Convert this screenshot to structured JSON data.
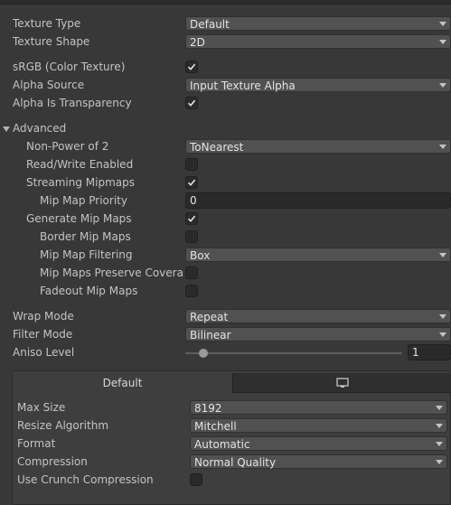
{
  "texture_type": {
    "label": "Texture Type",
    "value": "Default"
  },
  "texture_shape": {
    "label": "Texture Shape",
    "value": "2D"
  },
  "srgb": {
    "label": "sRGB (Color Texture)",
    "checked": true
  },
  "alpha_source": {
    "label": "Alpha Source",
    "value": "Input Texture Alpha"
  },
  "alpha_transparency": {
    "label": "Alpha Is Transparency",
    "checked": true
  },
  "advanced": {
    "label": "Advanced",
    "non_power_of_2": {
      "label": "Non-Power of 2",
      "value": "ToNearest"
    },
    "read_write": {
      "label": "Read/Write Enabled",
      "checked": false
    },
    "streaming_mipmaps": {
      "label": "Streaming Mipmaps",
      "checked": true
    },
    "mip_map_priority": {
      "label": "Mip Map Priority",
      "value": "0"
    },
    "generate_mip_maps": {
      "label": "Generate Mip Maps",
      "checked": true
    },
    "border_mip_maps": {
      "label": "Border Mip Maps",
      "checked": false
    },
    "mip_map_filtering": {
      "label": "Mip Map Filtering",
      "value": "Box"
    },
    "mip_maps_preserve_coverage": {
      "label": "Mip Maps Preserve Coverag",
      "checked": false
    },
    "fadeout_mip_maps": {
      "label": "Fadeout Mip Maps",
      "checked": false
    }
  },
  "wrap_mode": {
    "label": "Wrap Mode",
    "value": "Repeat"
  },
  "filter_mode": {
    "label": "Filter Mode",
    "value": "Bilinear"
  },
  "aniso_level": {
    "label": "Aniso Level",
    "value": "1"
  },
  "platform": {
    "tabs": [
      {
        "label": "Default",
        "active": true
      },
      {
        "icon": "monitor-icon",
        "active": false
      }
    ],
    "max_size": {
      "label": "Max Size",
      "value": "8192"
    },
    "resize_algorithm": {
      "label": "Resize Algorithm",
      "value": "Mitchell"
    },
    "format": {
      "label": "Format",
      "value": "Automatic"
    },
    "compression": {
      "label": "Compression",
      "value": "Normal Quality"
    },
    "crunch": {
      "label": "Use Crunch Compression",
      "checked": false
    }
  },
  "colors": {
    "background": "#383838",
    "field": "#515151",
    "text": "#c4c4c4"
  }
}
